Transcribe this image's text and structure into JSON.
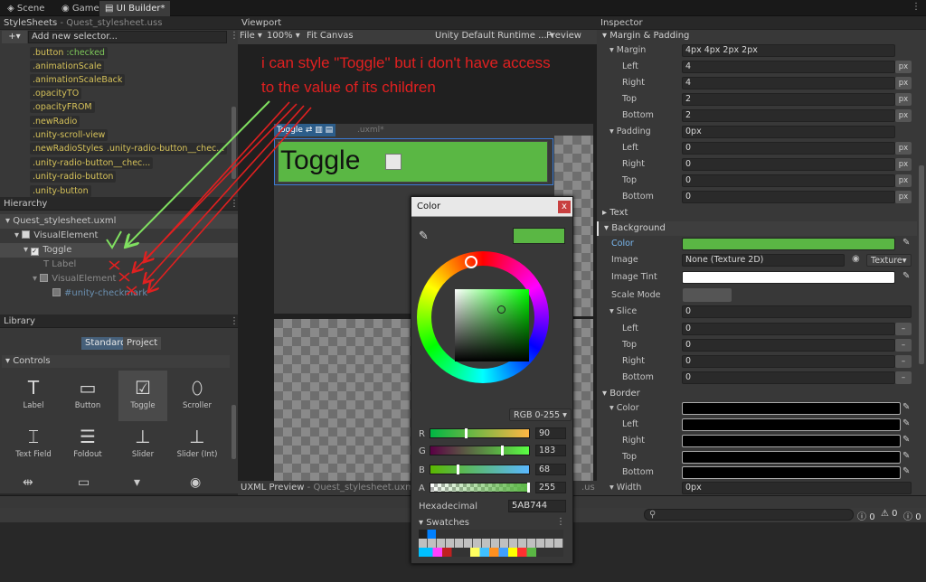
{
  "tabs": [
    "Scene",
    "Game",
    "UI Builder*"
  ],
  "stylesheets": {
    "title": "StyleSheets",
    "file": "- Quest_stylesheet.uss",
    "add_placeholder": "Add new selector...",
    "selectors": [
      ".button",
      ":checked",
      ".animationScale",
      ".animationScaleBack",
      ".opacityTO",
      ".opacityFROM",
      ".newRadio",
      ".unity-scroll-view",
      ".newRadioStyles",
      ".unity-radio-button__chec...",
      ".unity-radio-button__chec...",
      ".unity-radio-button",
      ".unity-button"
    ]
  },
  "hierarchy": {
    "title": "Hierarchy",
    "root": "Quest_stylesheet.uxml",
    "items": [
      "VisualElement",
      "Toggle",
      "Label",
      "VisualElement",
      "#unity-checkmark"
    ]
  },
  "library": {
    "title": "Library",
    "tab_standard": "Standard",
    "tab_project": "Project",
    "section": "Controls",
    "controls": [
      "Label",
      "Button",
      "Toggle",
      "Scroller",
      "Text Field",
      "Foldout",
      "Slider",
      "Slider (Int)"
    ]
  },
  "viewport": {
    "title": "Viewport",
    "file_menu": "File",
    "zoom": "100%",
    "fit": "Fit Canvas",
    "theme": "Unity Default Runtime ...",
    "preview": "Preview",
    "doc_tab": "Toggle",
    "doc_suffix": ".uxml*",
    "toggle_text": "Toggle",
    "uxml_preview": "UXML Preview",
    "uxml_file": "- Quest_stylesheet.uxml*",
    "uxml_suffix": ".us"
  },
  "annotation": {
    "line1": "i can style \"Toggle\" but i don't have access",
    "line2": "to the value of its children",
    "color": "#e02020"
  },
  "color_picker": {
    "title": "Color",
    "mode": "RGB 0-255",
    "r": "90",
    "g": "183",
    "b": "68",
    "a": "255",
    "hex_label": "Hexadecimal",
    "hex": "5AB744",
    "swatches_label": "Swatches",
    "r_label": "R",
    "g_label": "G",
    "b_label": "B",
    "a_label": "A",
    "current": "#5ab744"
  },
  "inspector": {
    "title": "Inspector",
    "margin_padding": "Margin & Padding",
    "margin_label": "Margin",
    "margin_value": "4px 4px 2px 2px",
    "margin_rows": [
      {
        "label": "Left",
        "value": "4"
      },
      {
        "label": "Right",
        "value": "4"
      },
      {
        "label": "Top",
        "value": "2"
      },
      {
        "label": "Bottom",
        "value": "2"
      }
    ],
    "padding_label": "Padding",
    "padding_value": "0px",
    "padding_rows": [
      {
        "label": "Left",
        "value": "0"
      },
      {
        "label": "Right",
        "value": "0"
      },
      {
        "label": "Top",
        "value": "0"
      },
      {
        "label": "Bottom",
        "value": "0"
      }
    ],
    "unit": "px",
    "text_section": "Text",
    "background_section": "Background",
    "color_label": "Color",
    "image_label": "Image",
    "image_value": "None (Texture 2D)",
    "image_type": "Texture",
    "tint_label": "Image Tint",
    "scale_label": "Scale Mode",
    "slice_label": "Slice",
    "slice_value": "0",
    "slice_rows": [
      {
        "label": "Left",
        "value": "0"
      },
      {
        "label": "Top",
        "value": "0"
      },
      {
        "label": "Right",
        "value": "0"
      },
      {
        "label": "Bottom",
        "value": "0"
      }
    ],
    "border_section": "Border",
    "border_rows": [
      "Color",
      "Left",
      "Right",
      "Top",
      "Bottom"
    ],
    "width_label": "Width",
    "width_value": "0px"
  },
  "status": {
    "c1": "0",
    "c2": "0",
    "c3": "0"
  }
}
